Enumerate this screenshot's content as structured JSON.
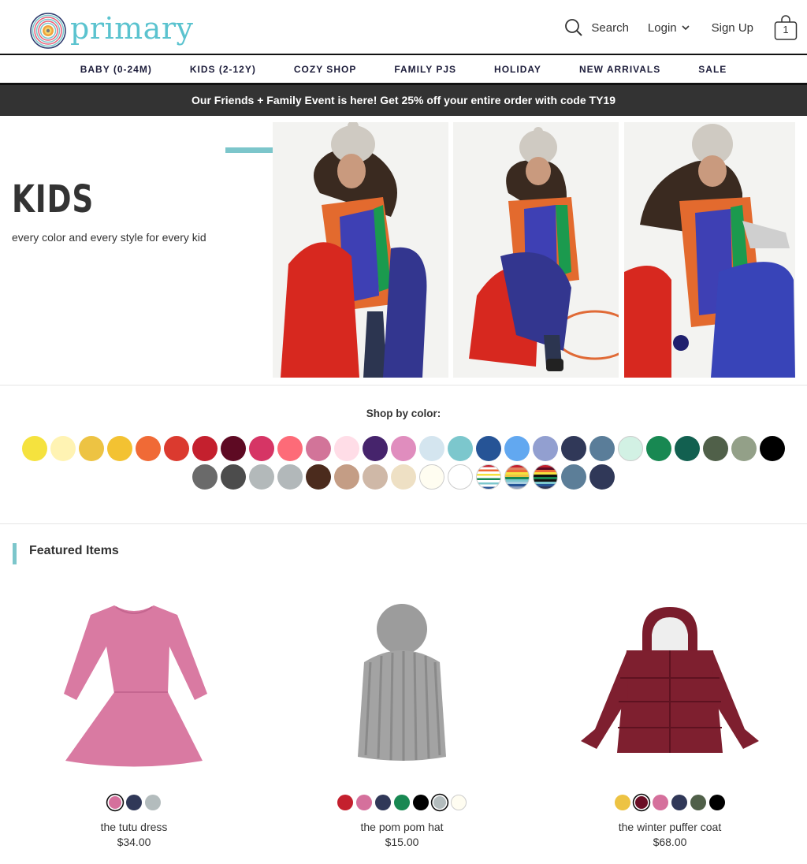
{
  "brand": {
    "name": "primary",
    "color": "#5bc3cf"
  },
  "header": {
    "search_label": "Search",
    "login_label": "Login",
    "signup_label": "Sign Up",
    "cart_count": "1"
  },
  "nav": {
    "items": [
      {
        "label": "BABY (0-24M)"
      },
      {
        "label": "KIDS (2-12Y)"
      },
      {
        "label": "COZY SHOP"
      },
      {
        "label": "FAMILY PJS"
      },
      {
        "label": "HOLIDAY"
      },
      {
        "label": "NEW ARRIVALS"
      },
      {
        "label": "SALE"
      }
    ]
  },
  "promo": {
    "text": "Our Friends + Family Event is here! Get 25% off your entire order with code TY19"
  },
  "hero": {
    "title": "KIDS",
    "subtitle": "every color and every style for every kid",
    "accent_color": "#7cc6cb"
  },
  "shop_by_color": {
    "title": "Shop by color:",
    "row1": [
      "#f5e23e",
      "#fff3b3",
      "#edc343",
      "#f3c232",
      "#f06a36",
      "#db3a2f",
      "#c4202e",
      "#5e0a23",
      "#d63565",
      "#fd6b78",
      "#d27499",
      "#ffdde7",
      "#46246c",
      "#e08dbe",
      "#d4e5ef",
      "#7cc7cd",
      "#265496",
      "#62a8f0",
      "#929fd0",
      "#303858",
      "#5a7d99",
      "#d2f1e4",
      "#188852",
      "#126050",
      "#506049",
      "#93a088",
      "#000000"
    ],
    "row2": [
      "#6a6a6a",
      "#4c4c4c",
      "#b3b9ba",
      "#b2b8ba",
      "#4b2b1d",
      "#c49d85",
      "#cfb8a7",
      "#eee0c4",
      "#fffdf1",
      "#ffffff",
      "stripe-a",
      "stripe-b",
      "stripe-c",
      "#5c7e98",
      "#303858"
    ]
  },
  "featured": {
    "title": "Featured Items",
    "products": [
      {
        "name": "the tutu dress",
        "price": "$34.00",
        "swatches": [
          "#d5709c",
          "#303858",
          "#b3bcbd"
        ],
        "selected": 0
      },
      {
        "name": "the pom pom hat",
        "price": "$15.00",
        "swatches": [
          "#c4202e",
          "#d5709c",
          "#303858",
          "#188852",
          "#000000",
          "#b3bcbd",
          "#fffdf1"
        ],
        "selected": 5
      },
      {
        "name": "the winter puffer coat",
        "price": "$68.00",
        "swatches": [
          "#edc343",
          "#6a0e25",
          "#d5709c",
          "#303858",
          "#506049",
          "#000000"
        ],
        "selected": 1
      }
    ]
  }
}
